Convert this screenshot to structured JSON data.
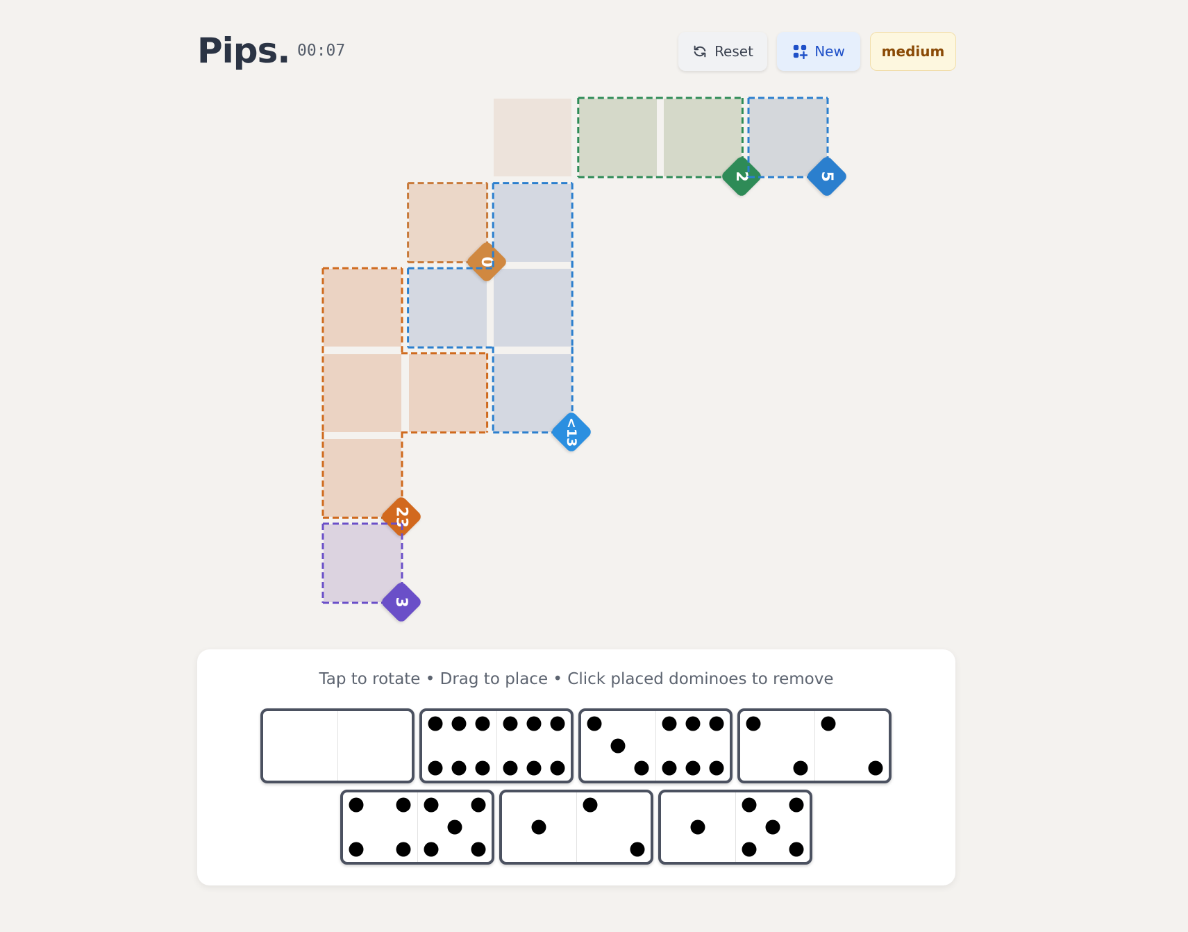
{
  "header": {
    "title": "Pips.",
    "timer": "00:07",
    "reset_label": "Reset",
    "new_label": "New",
    "difficulty": "medium"
  },
  "colors": {
    "orange": "#c87a3a",
    "blue": "#2b7fce",
    "green": "#2e8b57",
    "purple": "#6a4fc8",
    "dark_orange": "#cf6a1e"
  },
  "board": {
    "cells": [
      {
        "col": 2,
        "row": 0,
        "fill": "#ede3db"
      },
      {
        "col": 3,
        "row": 0,
        "fill": "#d5d9c9"
      },
      {
        "col": 4,
        "row": 0,
        "fill": "#d5d9c9"
      },
      {
        "col": 5,
        "row": 0,
        "fill": "#d4d7db"
      },
      {
        "col": 1,
        "row": 1,
        "fill": "#ebd7c8"
      },
      {
        "col": 2,
        "row": 1,
        "fill": "#d4d8e1"
      },
      {
        "col": 0,
        "row": 2,
        "fill": "#ebd3c3"
      },
      {
        "col": 1,
        "row": 2,
        "fill": "#d4d8e1"
      },
      {
        "col": 2,
        "row": 2,
        "fill": "#d4d8e1"
      },
      {
        "col": 0,
        "row": 3,
        "fill": "#ebd3c3"
      },
      {
        "col": 1,
        "row": 3,
        "fill": "#ebd3c3"
      },
      {
        "col": 2,
        "row": 3,
        "fill": "#d4d8e1"
      },
      {
        "col": 0,
        "row": 4,
        "fill": "#ebd3c3"
      },
      {
        "col": 0,
        "row": 5,
        "fill": "#dcd3e0"
      }
    ],
    "regions": [
      {
        "name": "green-region",
        "color": "#2e8b57",
        "cells": [
          [
            3,
            0
          ],
          [
            4,
            0
          ]
        ],
        "badge": "2",
        "badge_color": "#2e8b57",
        "badge_cell": [
          4,
          0
        ]
      },
      {
        "name": "blue-small-region",
        "color": "#2b7fce",
        "cells": [
          [
            5,
            0
          ]
        ],
        "badge": "5",
        "badge_color": "#2b7fce",
        "badge_cell": [
          5,
          0
        ]
      },
      {
        "name": "orange-small-region",
        "color": "#c87a3a",
        "cells": [
          [
            1,
            1
          ]
        ],
        "badge": "0",
        "badge_color": "#d08840",
        "badge_cell": [
          1,
          1
        ]
      },
      {
        "name": "blue-large-region",
        "color": "#2b7fce",
        "cells": [
          [
            2,
            1
          ],
          [
            1,
            2
          ],
          [
            2,
            2
          ],
          [
            2,
            3
          ]
        ],
        "badge": "<13",
        "badge_color": "#2b8fe0",
        "badge_cell": [
          2,
          3
        ]
      },
      {
        "name": "orange-large-region",
        "color": "#cf6a1e",
        "cells": [
          [
            0,
            2
          ],
          [
            0,
            3
          ],
          [
            1,
            3
          ],
          [
            0,
            4
          ]
        ],
        "badge": "23",
        "badge_color": "#d2691e",
        "badge_cell": [
          0,
          4
        ]
      },
      {
        "name": "purple-region",
        "color": "#6a4fc8",
        "cells": [
          [
            0,
            5
          ]
        ],
        "badge": "3",
        "badge_color": "#6a4fc8",
        "badge_cell": [
          0,
          5
        ]
      }
    ]
  },
  "tray": {
    "hint": "Tap to rotate • Drag to place • Click placed dominoes to remove",
    "dominoes": [
      [
        0,
        0
      ],
      [
        6,
        6
      ],
      [
        3,
        6
      ],
      [
        2,
        2
      ],
      [
        4,
        5
      ],
      [
        1,
        2
      ],
      [
        1,
        5
      ]
    ]
  }
}
